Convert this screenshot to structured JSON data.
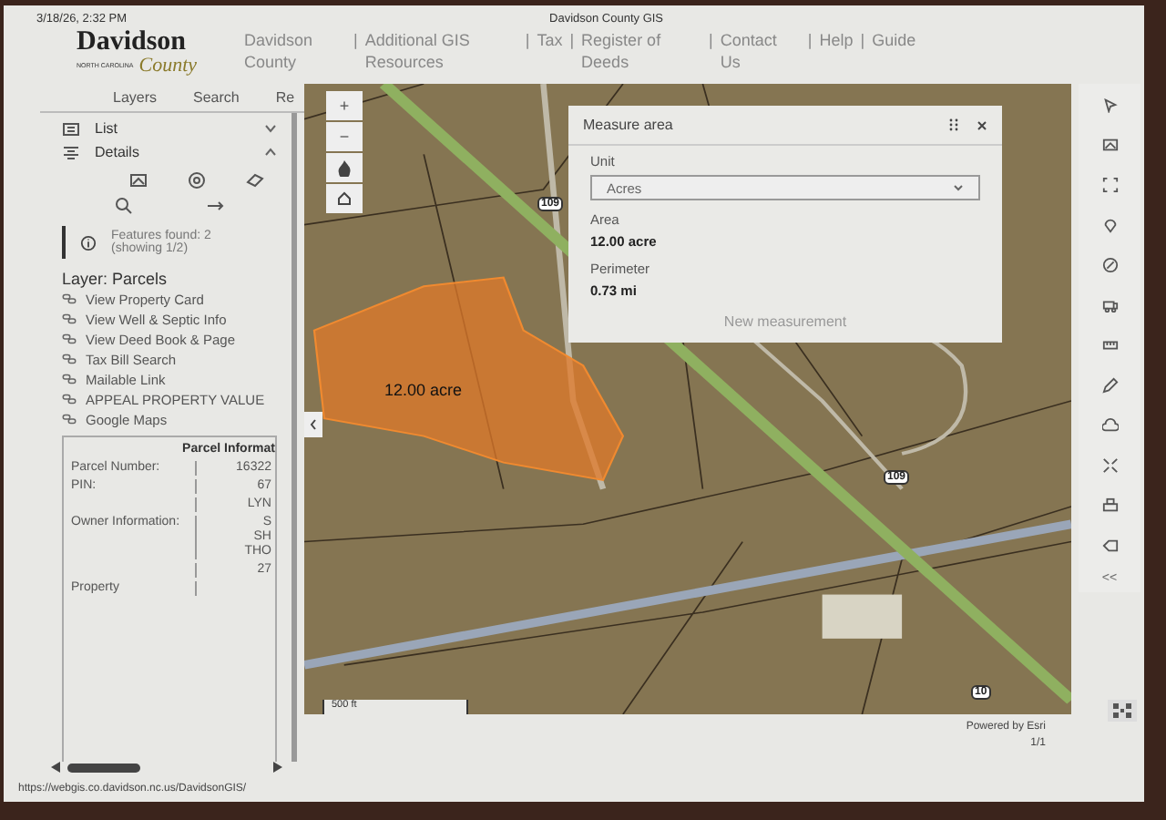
{
  "header": {
    "timestamp": "3/18/26, 2:32 PM",
    "page_title": "Davidson County GIS"
  },
  "logo": {
    "name": "Davidson",
    "state": "NORTH CAROLINA",
    "county": "County"
  },
  "nav": [
    {
      "label": "Davidson County"
    },
    {
      "divider": "|",
      "label": "Additional GIS Resources"
    },
    {
      "divider": "|",
      "label": "Tax"
    },
    {
      "divider": "|",
      "label": "Register of Deeds"
    },
    {
      "divider": "|",
      "label": "Contact Us"
    },
    {
      "divider": "|",
      "label": "Help"
    },
    {
      "divider": "|",
      "label": "Guide"
    }
  ],
  "sidebar": {
    "tabs": [
      {
        "label": "Layers"
      },
      {
        "label": "Search"
      },
      {
        "label": "Re"
      }
    ],
    "panels": [
      {
        "label": "List",
        "expanded": false
      },
      {
        "label": "Details",
        "expanded": true
      }
    ],
    "features_found": "Features found: 2 (showing 1/2)",
    "layer_title": "Layer: Parcels",
    "links": [
      {
        "label": "View Property Card"
      },
      {
        "label": "View Well & Septic Info"
      },
      {
        "label": "View Deed Book & Page"
      },
      {
        "label": "Tax Bill Search"
      },
      {
        "label": "Mailable Link"
      },
      {
        "label": "APPEAL PROPERTY VALUE"
      },
      {
        "label": "Google Maps"
      }
    ],
    "parcel_info": {
      "title": "Parcel Informat",
      "rows": [
        {
          "label": "Parcel Number:",
          "values": [
            "16322"
          ]
        },
        {
          "label": "PIN:",
          "values": [
            "67"
          ]
        },
        {
          "values": [
            "LYN"
          ]
        },
        {
          "label": "Owner Information:",
          "values": [
            "S",
            "SH",
            "THO"
          ]
        },
        {
          "values": [
            "27"
          ]
        },
        {
          "label": "Property"
        }
      ]
    }
  },
  "map": {
    "zoom": [
      "+",
      "−"
    ],
    "parcel_label": "12.00 acre",
    "route_shields": [
      "109",
      "109",
      "10"
    ],
    "scale": "500 ft",
    "collapse": "<<"
  },
  "measure": {
    "title": "Measure area",
    "unit_label": "Unit",
    "unit": "Acres",
    "area_label": "Area",
    "area": "12.00 acre",
    "perimeter_label": "Perimeter",
    "perimeter": "0.73 mi",
    "button": "New measurement"
  },
  "footer": {
    "url": "https://webgis.co.davidson.nc.us/DavidsonGIS/",
    "attribution": "Powered by Esri",
    "page": "1/1"
  }
}
